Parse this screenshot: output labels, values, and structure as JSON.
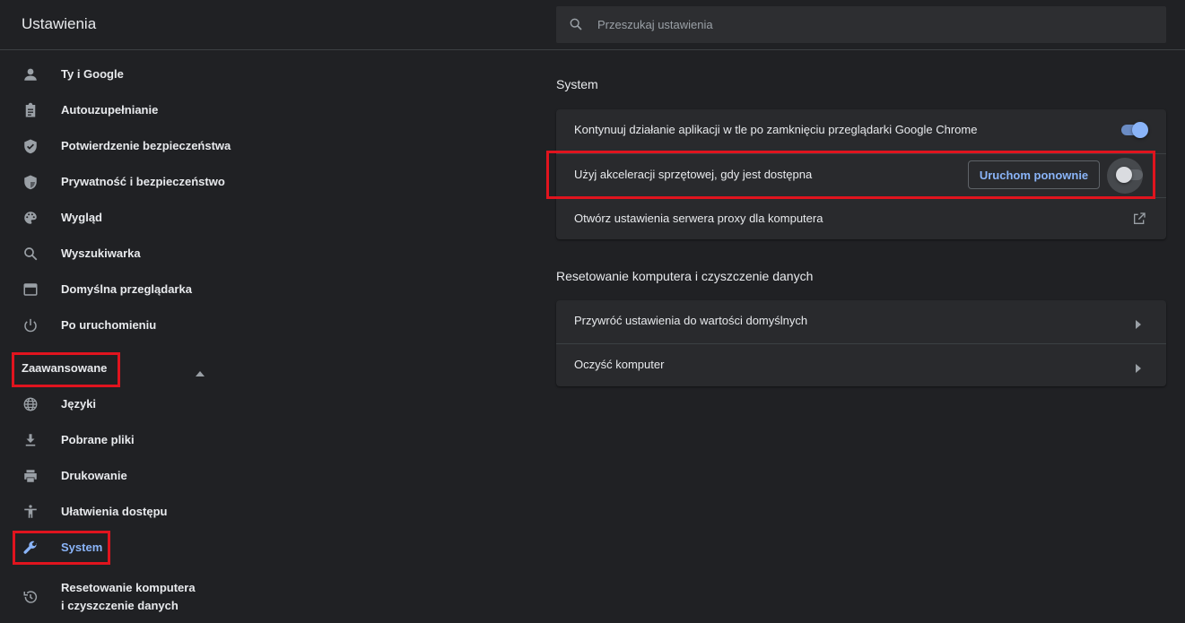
{
  "header": {
    "title": "Ustawienia",
    "search_placeholder": "Przeszukaj ustawienia"
  },
  "sidebar": {
    "items": [
      {
        "label": "Ty i Google",
        "icon": "person-icon"
      },
      {
        "label": "Autouzupełnianie",
        "icon": "clipboard-icon"
      },
      {
        "label": "Potwierdzenie bezpieczeństwa",
        "icon": "shield-check-icon"
      },
      {
        "label": "Prywatność i bezpieczeństwo",
        "icon": "shield-icon"
      },
      {
        "label": "Wygląd",
        "icon": "palette-icon"
      },
      {
        "label": "Wyszukiwarka",
        "icon": "search-icon"
      },
      {
        "label": "Domyślna przeglądarka",
        "icon": "browser-icon"
      },
      {
        "label": "Po uruchomieniu",
        "icon": "power-icon"
      }
    ],
    "advanced_label": "Zaawansowane",
    "advanced_items": [
      {
        "label": "Języki",
        "icon": "globe-icon"
      },
      {
        "label": "Pobrane pliki",
        "icon": "download-icon"
      },
      {
        "label": "Drukowanie",
        "icon": "printer-icon"
      },
      {
        "label": "Ułatwienia dostępu",
        "icon": "accessibility-icon"
      },
      {
        "label": "System",
        "icon": "wrench-icon",
        "active": true
      },
      {
        "label_line1": "Resetowanie komputera",
        "label_line2": "i czyszczenie danych",
        "icon": "restore-icon"
      }
    ]
  },
  "main": {
    "system_section": {
      "title": "System",
      "rows": [
        {
          "label": "Kontynuuj działanie aplikacji w tle po zamknięciu przeglądarki Google Chrome",
          "toggle": true
        },
        {
          "label": "Użyj akceleracji sprzętowej, gdy jest dostępna",
          "button": "Uruchom ponownie",
          "toggle": false
        },
        {
          "label": "Otwórz ustawienia serwera proxy dla komputera",
          "icon": "external-link-icon"
        }
      ]
    },
    "reset_section": {
      "title": "Resetowanie komputera i czyszczenie danych",
      "rows": [
        {
          "label": "Przywróć ustawienia do wartości domyślnych",
          "icon": "chevron-right-icon"
        },
        {
          "label": "Oczyść komputer",
          "icon": "chevron-right-icon"
        }
      ]
    }
  },
  "colors": {
    "background": "#202124",
    "card": "#292a2d",
    "accent": "#8ab4f8",
    "highlight": "#e0141e"
  }
}
